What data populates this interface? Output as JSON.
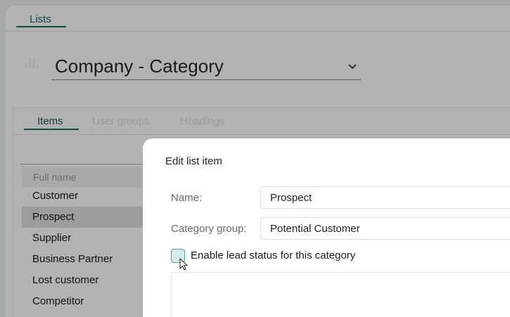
{
  "top_tabs": [
    {
      "label": "Lists"
    }
  ],
  "list_selector": {
    "value": "Company - Category"
  },
  "card_tabs": [
    {
      "label": "Items",
      "active": true
    },
    {
      "label": "User groups"
    },
    {
      "label": "Headings"
    }
  ],
  "table": {
    "header": "Full name",
    "rows": [
      "Customer",
      "Prospect",
      "Supplier",
      "Business Partner",
      "Lost customer",
      "Competitor"
    ],
    "selected": "Prospect"
  },
  "modal": {
    "title": "Edit list item",
    "name_label": "Name:",
    "name_value": "Prospect",
    "category_label": "Category group:",
    "category_value": "Potential Customer",
    "checkbox_label": "Enable lead status for this category",
    "checkbox_checked": false
  },
  "colors": {
    "accent": "#0f4a45",
    "checkbox_border": "#4aa58f"
  }
}
